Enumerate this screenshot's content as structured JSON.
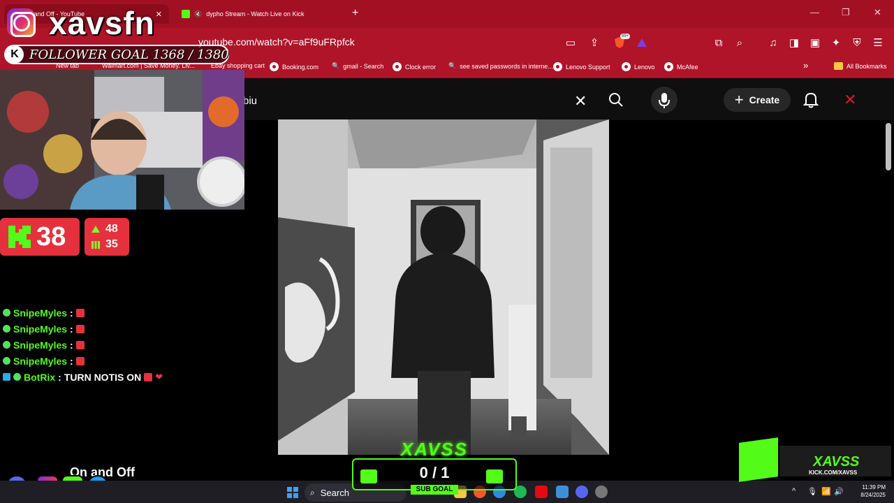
{
  "browser": {
    "tabs": [
      {
        "label": "On and Off - YouTube",
        "active": true
      },
      {
        "label": "dypho Stream - Watch Live on Kick",
        "active": false
      }
    ],
    "new_tab": "+",
    "address": "youtube.com/watch?v=aFf9uFRpfck",
    "extension_badge": "99+",
    "bookmarks": [
      "New tab",
      "Walmart.com | Save Money. Liv...",
      "Ebay shopping cart",
      "Booking.com",
      "gmail - Search",
      "Clock error",
      "see saved passwords in interne...",
      "Lenovo Support",
      "Lenovo",
      "McAfee"
    ],
    "all_bookmarks": "All Bookmarks",
    "more": "»"
  },
  "youtube": {
    "search_value": "biu",
    "clear": "✕",
    "create_label": "Create",
    "create_plus": "+"
  },
  "overlay": {
    "handle": "xavsfn",
    "kick_k": "K",
    "follower_goal": "FOLLOWER GOAL 1368 / 1380",
    "viewers": "38",
    "stat_up": "48",
    "stat_bars": "35",
    "chat": [
      {
        "name": "SnipeMyles",
        "sep": " :",
        "msg": ""
      },
      {
        "name": "SnipeMyles",
        "sep": " :",
        "msg": ""
      },
      {
        "name": "SnipeMyles",
        "sep": " :",
        "msg": ""
      },
      {
        "name": "SnipeMyles",
        "sep": " :",
        "msg": ""
      },
      {
        "name": "BotRix",
        "sep": " :",
        "msg": "TURN NOTIS ON"
      }
    ],
    "now_playing": "On and Off",
    "sub_brand": "XAVSS",
    "sub_count": "0 / 1",
    "sub_label": "SUB GOAL",
    "kick_name": "XAVSS",
    "kick_url": "KICK.COM/XAVSS",
    "heart": "❤"
  },
  "taskbar": {
    "search_label": "Search",
    "time": "11:39 PM",
    "date": "8/24/2025",
    "tray_caret": "^"
  }
}
